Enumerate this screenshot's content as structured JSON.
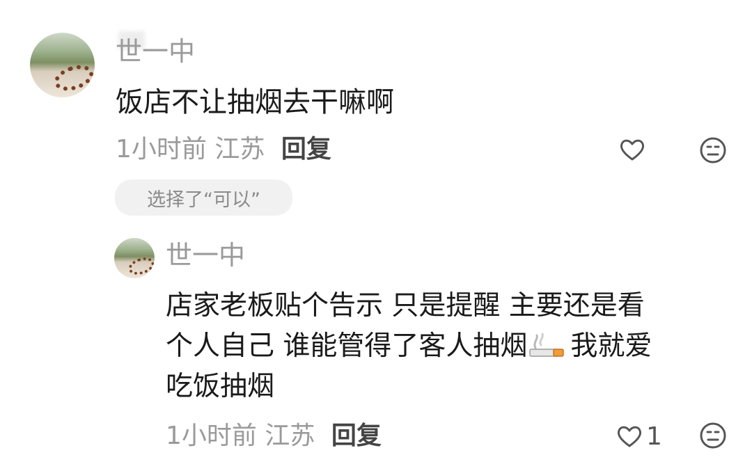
{
  "comment": {
    "username": "世一中",
    "text": "饭店不让抽烟去干嘛啊",
    "time": "1小时前",
    "location": "江苏",
    "reply_label": "回复",
    "chip_label": "选择了“可以”",
    "like_icon": "heart-outline-icon",
    "dislike_icon": "meh-face-icon"
  },
  "reply": {
    "username": "世一中",
    "text_line1": "店家老板贴个告示 只是提醒 主要还是看",
    "text_line2a": "个人自己 谁能管得了客人抽烟",
    "text_line2b": "我就爱",
    "text_line3": "吃饭抽烟",
    "emoji": "cigarette-emoji",
    "time": "1小时前",
    "location": "江苏",
    "reply_label": "回复",
    "like_count": "1",
    "like_icon": "heart-outline-icon",
    "dislike_icon": "meh-face-icon"
  }
}
